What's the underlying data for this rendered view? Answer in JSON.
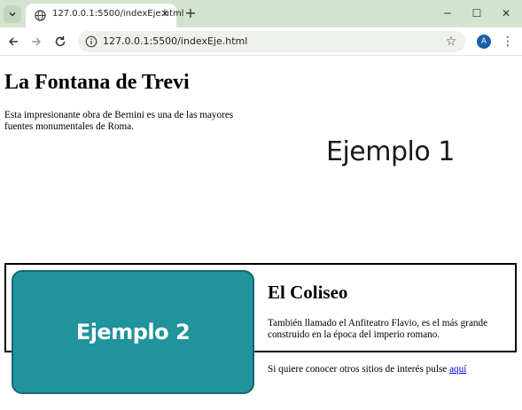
{
  "browser": {
    "tab_title": "127.0.0.1:5500/indexEje.html",
    "new_tab_label": "+",
    "close_tab_label": "✕",
    "url": "127.0.0.1:5500/indexEje.html",
    "profile_initial": "A",
    "window_controls": {
      "minimize": "─",
      "maximize": "☐",
      "close": "✕"
    },
    "menu_label": "⋮",
    "bookmark_label": "☆"
  },
  "page": {
    "section1": {
      "heading": "La Fontana de Trevi",
      "text": "Esta impresionante obra de Bernini es una de las mayores fuentes monumentales de Roma.",
      "image_label": "Ejemplo 1"
    },
    "section2": {
      "image_label": "Ejemplo 2",
      "heading": "El Coliseo",
      "text": "También llamado el Anfiteatro Flavio, es el más grande construido en la época del imperio romano.",
      "more_text": "Si quiere conocer otros sitios de interés pulse ",
      "link_text": "aquí"
    }
  },
  "colors": {
    "tabstrip": "#d3e3cf",
    "example2_fill": "#20939c",
    "example2_border": "#126a72",
    "link": "#0000ee"
  }
}
